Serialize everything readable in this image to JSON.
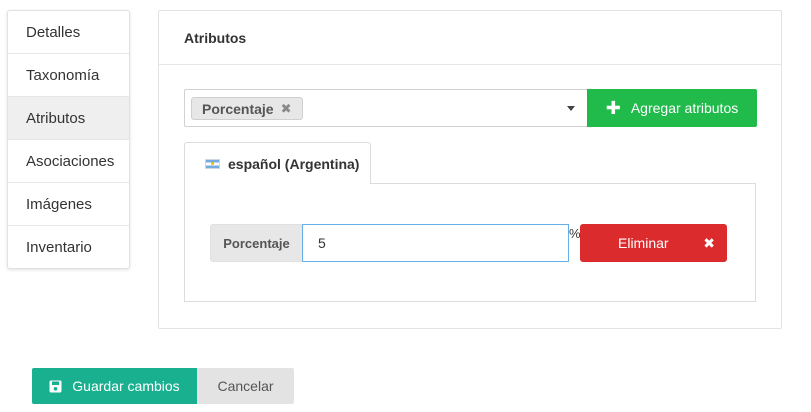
{
  "sidebar": {
    "items": [
      {
        "label": "Detalles"
      },
      {
        "label": "Taxonomía"
      },
      {
        "label": "Atributos"
      },
      {
        "label": "Asociaciones"
      },
      {
        "label": "Imágenes"
      },
      {
        "label": "Inventario"
      }
    ],
    "active_index": 2
  },
  "panel": {
    "title": "Atributos",
    "attribute_select": {
      "selected_tags": [
        "Porcentaje"
      ],
      "remove_icon": "times-icon"
    },
    "add_button": {
      "label": "Agregar atributos",
      "icon": "plus-icon"
    },
    "locale_tab": {
      "label": "español (Argentina)",
      "icon": "flag-argentina-icon"
    },
    "attribute_row": {
      "label": "Porcentaje",
      "value": "5",
      "unit": "%",
      "delete_label": "Eliminar",
      "delete_icon": "times-icon"
    }
  },
  "actions": {
    "save_label": "Guardar cambios",
    "save_icon": "floppy-disk-icon",
    "cancel_label": "Cancelar"
  },
  "colors": {
    "add_button": "#21bb4c",
    "delete_button": "#dc2b2d",
    "save_button": "#18b08f",
    "cancel_button": "#e3e3e3",
    "focus_border": "#66afe9"
  }
}
